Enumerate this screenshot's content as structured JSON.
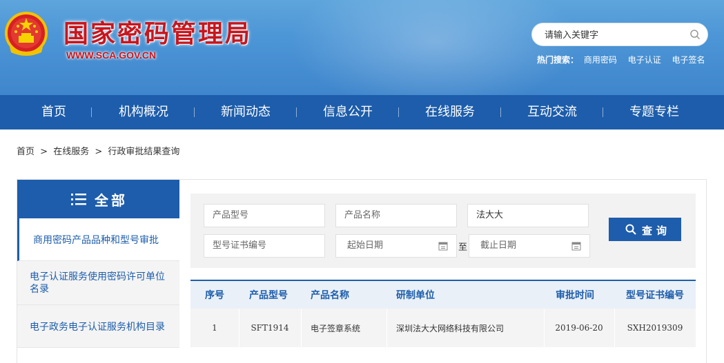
{
  "header": {
    "site_title": "国家密码管理局",
    "site_url": "WWW.SCA.GOV.CN",
    "search_placeholder": "请输入关键字",
    "hot_label": "热门搜索：",
    "hot_terms": [
      "商用密码",
      "电子认证",
      "电子签名"
    ]
  },
  "nav": {
    "items": [
      "首页",
      "机构概况",
      "新闻动态",
      "信息公开",
      "在线服务",
      "互动交流",
      "专题专栏"
    ]
  },
  "breadcrumb": [
    "首页",
    ">",
    "在线服务",
    ">",
    "行政审批结果查询"
  ],
  "sidebar": {
    "title": "全部",
    "items": [
      {
        "label": "商用密码产品品种和型号审批",
        "active": true
      },
      {
        "label": "电子认证服务使用密码许可单位名录",
        "active": false
      },
      {
        "label": "电子政务电子认证服务机构目录",
        "active": false
      }
    ]
  },
  "search_form": {
    "product_model_placeholder": "产品型号",
    "product_name_placeholder": "产品名称",
    "unit_value": "法大大",
    "cert_no_placeholder": "型号证书编号",
    "start_date_placeholder": "起始日期",
    "to_label": "至",
    "end_date_placeholder": "截止日期",
    "query_label": "查询"
  },
  "table": {
    "headers": [
      "序号",
      "产品型号",
      "产品名称",
      "研制单位",
      "审批时间",
      "型号证书编号"
    ],
    "rows": [
      [
        "1",
        "SFT1914",
        "电子签章系统",
        "深圳法大大网络科技有限公司",
        "2019-06-20",
        "SXH2019309"
      ]
    ]
  },
  "colors": {
    "primary": "#1d5dab",
    "title_red": "#c8161d"
  }
}
